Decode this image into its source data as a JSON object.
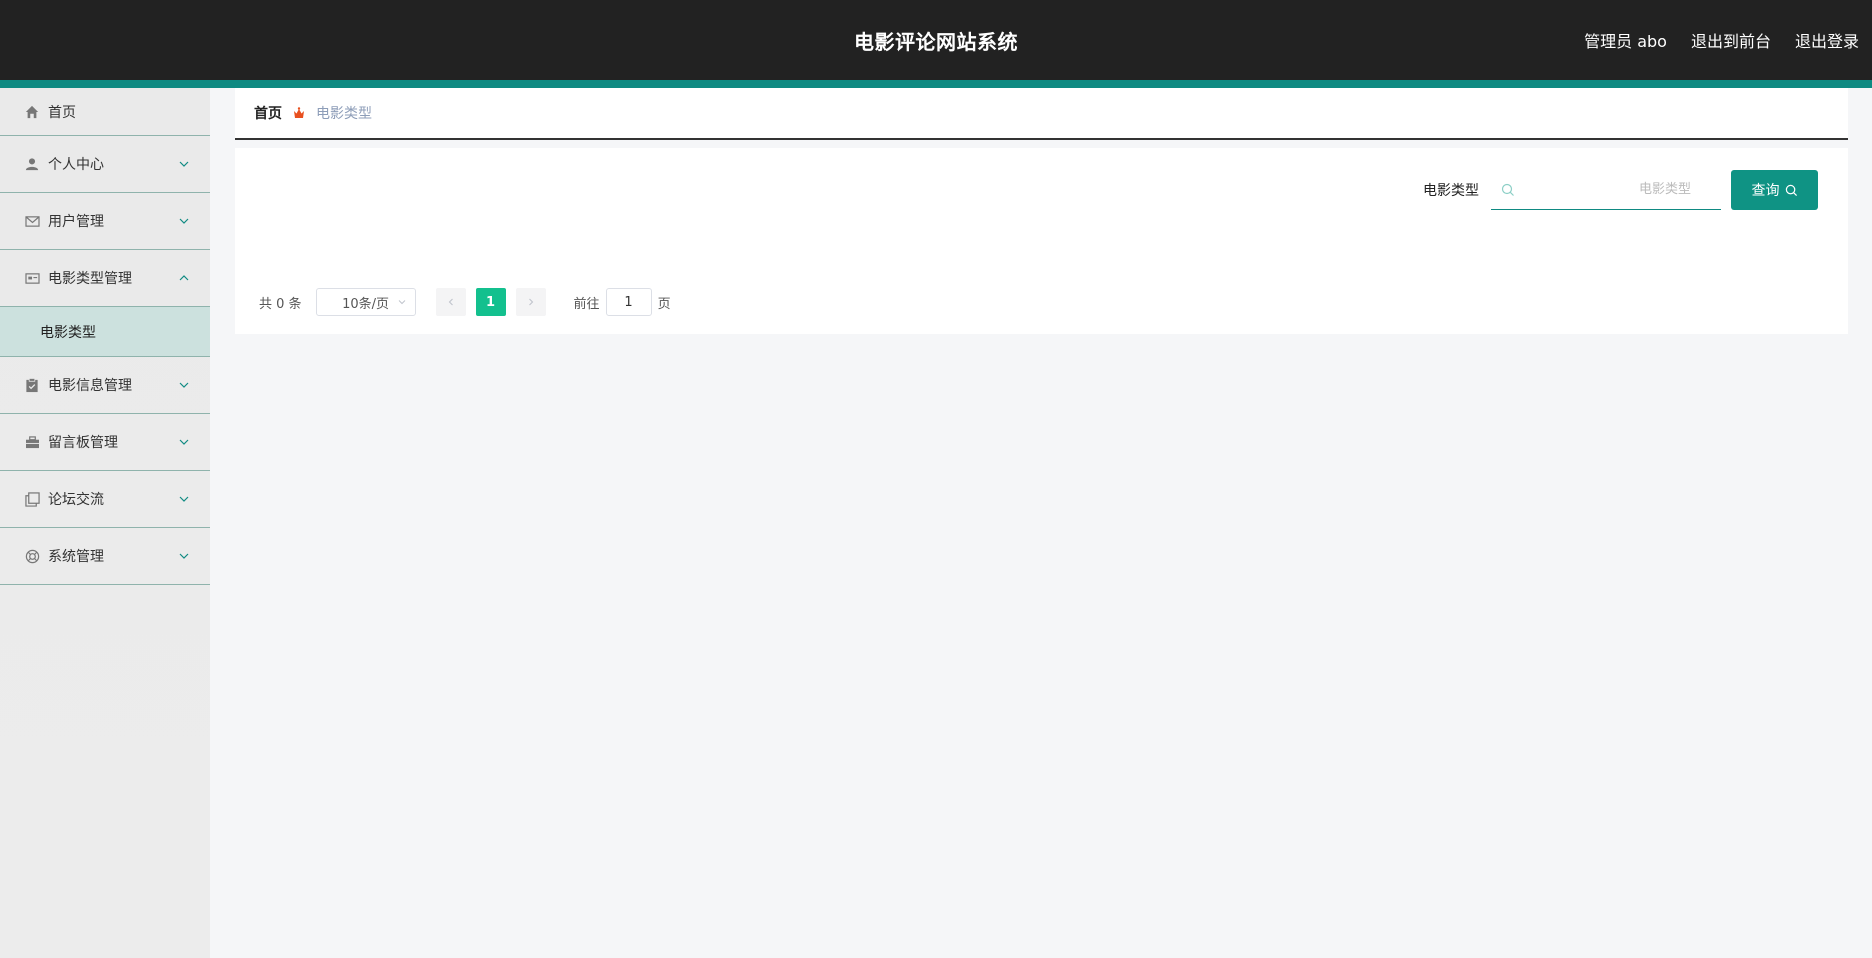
{
  "header": {
    "title": "电影评论网站系统",
    "user": "管理员 abo",
    "to_frontend": "退出到前台",
    "logout": "退出登录"
  },
  "sidebar": {
    "items": [
      {
        "label": "首页",
        "icon": "home-icon"
      },
      {
        "label": "个人中心",
        "icon": "user-icon"
      },
      {
        "label": "用户管理",
        "icon": "mail-icon"
      },
      {
        "label": "电影类型管理",
        "icon": "id-card-icon",
        "expanded": true,
        "children": [
          {
            "label": "电影类型",
            "active": true
          }
        ]
      },
      {
        "label": "电影信息管理",
        "icon": "clipboard-icon"
      },
      {
        "label": "留言板管理",
        "icon": "briefcase-icon"
      },
      {
        "label": "论坛交流",
        "icon": "copy-icon"
      },
      {
        "label": "系统管理",
        "icon": "lifebuoy-icon"
      }
    ]
  },
  "breadcrumb": {
    "home": "首页",
    "current": "电影类型"
  },
  "search": {
    "label": "电影类型",
    "placeholder": "电影类型",
    "button": "查询"
  },
  "pagination": {
    "total_text": "共 0 条",
    "page_size": "10条/页",
    "current_page": "1",
    "goto_label": "前往",
    "goto_value": "1",
    "page_suffix": "页"
  },
  "colors": {
    "header_bg": "#222222",
    "accent": "#0f8a82",
    "button": "#0f9384",
    "active_page": "#13c08e",
    "submenu_active": "#cce1de"
  }
}
